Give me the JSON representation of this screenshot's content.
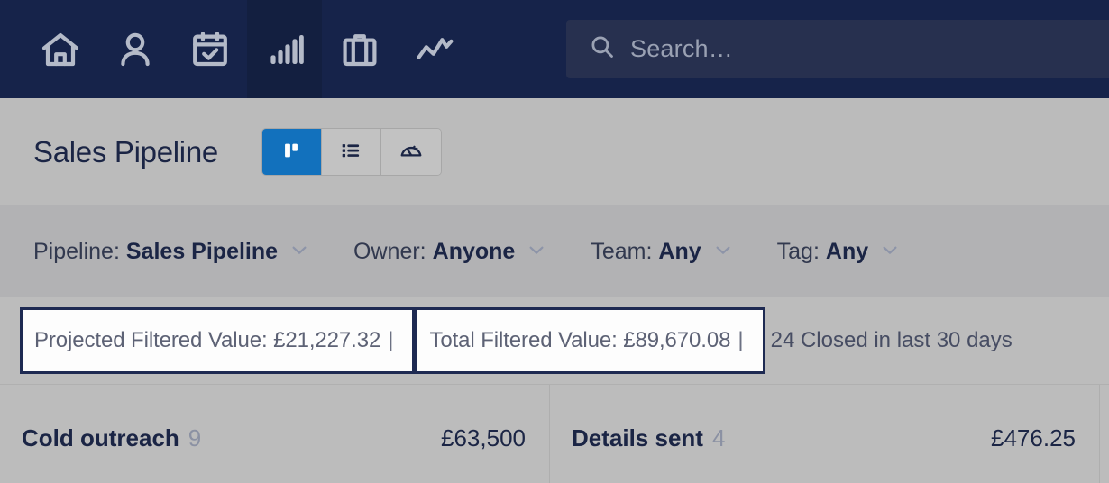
{
  "topnav": {
    "background": "#16234a",
    "active_background": "#131f40",
    "items": [
      {
        "name": "home",
        "icon": "home-icon",
        "label": "Home",
        "active": false
      },
      {
        "name": "contacts",
        "icon": "person-icon",
        "label": "Contacts",
        "active": false
      },
      {
        "name": "calendar",
        "icon": "calendar-icon",
        "label": "Calendar",
        "active": false
      },
      {
        "name": "pipeline",
        "icon": "bar-chart-icon",
        "label": "Pipeline",
        "active": true
      },
      {
        "name": "projects",
        "icon": "briefcase-icon",
        "label": "Projects",
        "active": false
      },
      {
        "name": "reports",
        "icon": "trend-line-icon",
        "label": "Reports",
        "active": false
      }
    ]
  },
  "search": {
    "icon": "search-icon",
    "placeholder": "Search…",
    "value": ""
  },
  "header": {
    "title": "Sales Pipeline",
    "accent_color": "#1271bd",
    "views": [
      {
        "name": "kanban",
        "icon": "kanban-icon",
        "label": "Board view",
        "active": true
      },
      {
        "name": "list",
        "icon": "list-icon",
        "label": "List view",
        "active": false
      },
      {
        "name": "dashboard",
        "icon": "gauge-icon",
        "label": "Dashboard view",
        "active": false
      }
    ]
  },
  "filters": [
    {
      "name": "pipeline",
      "label": "Pipeline:",
      "value": "Sales Pipeline",
      "chevron": "chevron-down-icon"
    },
    {
      "name": "owner",
      "label": "Owner:",
      "value": "Anyone",
      "chevron": "chevron-down-icon"
    },
    {
      "name": "team",
      "label": "Team:",
      "value": "Any",
      "chevron": "chevron-down-icon"
    },
    {
      "name": "tag",
      "label": "Tag:",
      "value": "Any",
      "chevron": "chevron-down-icon"
    }
  ],
  "summary": {
    "projected_filtered_value": "Projected Filtered Value: £21,227.32",
    "total_filtered_value": "Total Filtered Value: £89,670.08",
    "separator_1": "|",
    "separator_2": "|",
    "closed_text": "24 Closed in last 30 days",
    "box_border_color": "#1e2a52"
  },
  "columns": [
    {
      "name": "cold-outreach",
      "title": "Cold outreach",
      "count": "9",
      "value": "£63,500"
    },
    {
      "name": "details-sent",
      "title": "Details sent",
      "count": "4",
      "value": "£476.25"
    }
  ]
}
